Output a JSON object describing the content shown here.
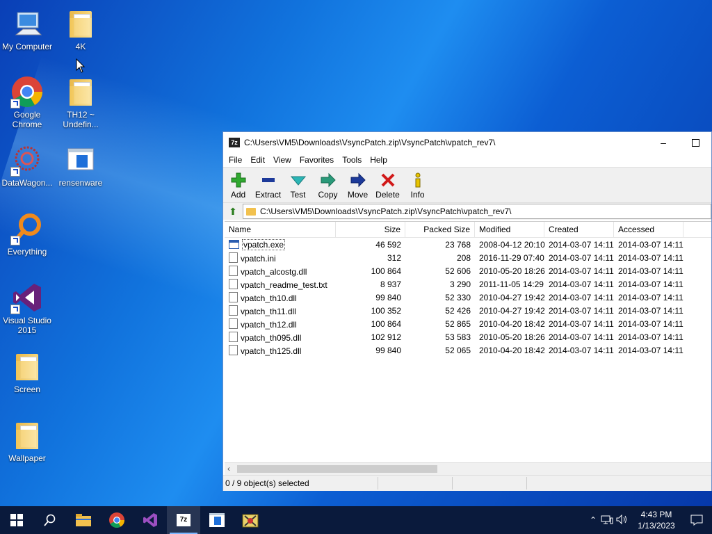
{
  "desktop": {
    "icons": [
      {
        "label": "My Computer",
        "icon": "computer-icon"
      },
      {
        "label": "4K",
        "icon": "folder-icon"
      },
      {
        "label": "Google Chrome",
        "icon": "chrome-icon"
      },
      {
        "label": "TH12 ~ Undefin...",
        "icon": "folder-icon"
      },
      {
        "label": "DataWagon...",
        "icon": "datawagon-icon"
      },
      {
        "label": "rensenware",
        "icon": "window-app-icon"
      },
      {
        "label": "Everything",
        "icon": "everything-search-icon"
      },
      {
        "label": "Visual Studio 2015",
        "icon": "visual-studio-icon"
      },
      {
        "label": "Screen",
        "icon": "folder-icon"
      },
      {
        "label": "Wallpaper",
        "icon": "folder-icon"
      }
    ]
  },
  "window": {
    "title": "C:\\Users\\VM5\\Downloads\\VsyncPatch.zip\\VsyncPatch\\vpatch_rev7\\",
    "app_icon": "7z",
    "menu": [
      "File",
      "Edit",
      "View",
      "Favorites",
      "Tools",
      "Help"
    ],
    "toolbar": [
      {
        "label": "Add",
        "icon": "plus-icon",
        "color": "#2fa82f"
      },
      {
        "label": "Extract",
        "icon": "minus-icon",
        "color": "#1d3a9a"
      },
      {
        "label": "Test",
        "icon": "check-icon",
        "color": "#2bb5b5"
      },
      {
        "label": "Copy",
        "icon": "arrow-right-icon",
        "color": "#2a9a7a"
      },
      {
        "label": "Move",
        "icon": "arrow-right-icon",
        "color": "#1d3a9a"
      },
      {
        "label": "Delete",
        "icon": "x-icon",
        "color": "#d11a1a"
      },
      {
        "label": "Info",
        "icon": "info-icon",
        "color": "#c9a800"
      }
    ],
    "address": "C:\\Users\\VM5\\Downloads\\VsyncPatch.zip\\VsyncPatch\\vpatch_rev7\\",
    "columns": [
      "Name",
      "Size",
      "Packed Size",
      "Modified",
      "Created",
      "Accessed"
    ],
    "files": [
      {
        "name": "vpatch.exe",
        "size": "46 592",
        "packed": "23 768",
        "modified": "2008-04-12 20:10",
        "created": "2014-03-07 14:11",
        "accessed": "2014-03-07 14:11",
        "type": "exe"
      },
      {
        "name": "vpatch.ini",
        "size": "312",
        "packed": "208",
        "modified": "2016-11-29 07:40",
        "created": "2014-03-07 14:11",
        "accessed": "2014-03-07 14:11",
        "type": "ini"
      },
      {
        "name": "vpatch_alcostg.dll",
        "size": "100 864",
        "packed": "52 606",
        "modified": "2010-05-20 18:26",
        "created": "2014-03-07 14:11",
        "accessed": "2014-03-07 14:11",
        "type": "dll"
      },
      {
        "name": "vpatch_readme_test.txt",
        "size": "8 937",
        "packed": "3 290",
        "modified": "2011-11-05 14:29",
        "created": "2014-03-07 14:11",
        "accessed": "2014-03-07 14:11",
        "type": "txt"
      },
      {
        "name": "vpatch_th10.dll",
        "size": "99 840",
        "packed": "52 330",
        "modified": "2010-04-27 19:42",
        "created": "2014-03-07 14:11",
        "accessed": "2014-03-07 14:11",
        "type": "dll"
      },
      {
        "name": "vpatch_th11.dll",
        "size": "100 352",
        "packed": "52 426",
        "modified": "2010-04-27 19:42",
        "created": "2014-03-07 14:11",
        "accessed": "2014-03-07 14:11",
        "type": "dll"
      },
      {
        "name": "vpatch_th12.dll",
        "size": "100 864",
        "packed": "52 865",
        "modified": "2010-04-20 18:42",
        "created": "2014-03-07 14:11",
        "accessed": "2014-03-07 14:11",
        "type": "dll"
      },
      {
        "name": "vpatch_th095.dll",
        "size": "102 912",
        "packed": "53 583",
        "modified": "2010-05-20 18:26",
        "created": "2014-03-07 14:11",
        "accessed": "2014-03-07 14:11",
        "type": "dll"
      },
      {
        "name": "vpatch_th125.dll",
        "size": "99 840",
        "packed": "52 065",
        "modified": "2010-04-20 18:42",
        "created": "2014-03-07 14:11",
        "accessed": "2014-03-07 14:11",
        "type": "dll"
      }
    ],
    "status": "0 / 9 object(s) selected"
  },
  "taskbar": {
    "apps": [
      "start-icon",
      "search-icon",
      "file-explorer-icon",
      "chrome-icon",
      "visual-studio-icon",
      "7zip-icon",
      "rensenware-icon",
      "game-icon"
    ],
    "time": "4:43 PM",
    "date": "1/13/2023"
  }
}
